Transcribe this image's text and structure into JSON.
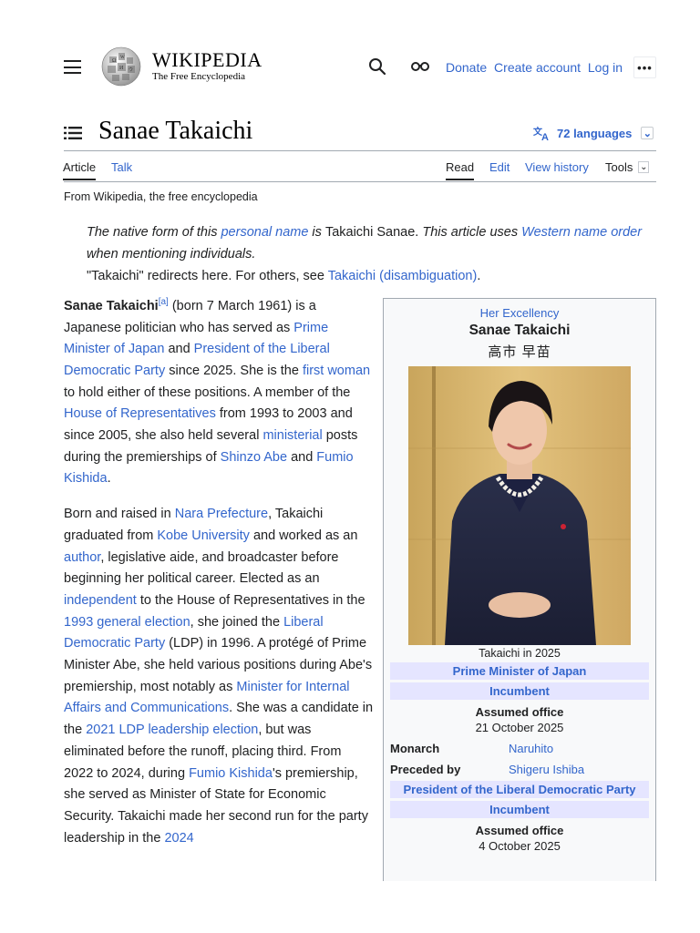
{
  "header": {
    "wordmark_title": "WIKIPEDIA",
    "wordmark_tagline": "The Free Encyclopedia",
    "links": [
      "Donate",
      "Create account",
      "Log in"
    ]
  },
  "page": {
    "title": "Sanae Takaichi",
    "languages": "72 languages",
    "tabs_left": [
      "Article",
      "Talk"
    ],
    "tabs_right": [
      "Read",
      "Edit",
      "View history"
    ],
    "tools": "Tools",
    "tagline": "From Wikipedia, the free encyclopedia"
  },
  "hatnote": {
    "p1": "The native form of this ",
    "p1_link": "personal name",
    "p2": " is ",
    "p2_plain": "Takaichi Sanae.",
    "p3": " This article uses ",
    "p3_link": "Western name order",
    "p4": " when mentioning individuals.",
    "p5": "\"Takaichi\" redirects here. For others, see ",
    "p5_link": "Takaichi (disambiguation)",
    "p5_end": "."
  },
  "lead": {
    "para1": [
      {
        "t": "Sanae Takaichi",
        "b": true
      },
      {
        "t": "[a]",
        "sup": true,
        "link": true
      },
      {
        "t": " (born 7 March 1961) is a Japanese politician who has served as "
      },
      {
        "t": "Prime Minister of Japan",
        "link": true
      },
      {
        "t": " and "
      },
      {
        "t": "President of the Liberal Democratic Party",
        "link": true
      },
      {
        "t": " since 2025. She is the "
      },
      {
        "t": "first woman",
        "link": true
      },
      {
        "t": " to hold either of these positions. A member of the "
      },
      {
        "t": "House of Representatives",
        "link": true
      },
      {
        "t": " from 1993 to 2003 and since 2005, she also held several "
      },
      {
        "t": "ministerial",
        "link": true
      },
      {
        "t": " posts during the premierships of "
      },
      {
        "t": "Shinzo Abe",
        "link": true
      },
      {
        "t": " and "
      },
      {
        "t": "Fumio Kishida",
        "link": true
      },
      {
        "t": "."
      }
    ],
    "para2": [
      {
        "t": "Born and raised in "
      },
      {
        "t": "Nara Prefecture",
        "link": true
      },
      {
        "t": ", Takaichi graduated from "
      },
      {
        "t": "Kobe University",
        "link": true
      },
      {
        "t": " and worked as an "
      },
      {
        "t": "author",
        "link": true
      },
      {
        "t": ", legislative aide, and broadcaster before beginning her political career. Elected as an "
      },
      {
        "t": "independent",
        "link": true
      },
      {
        "t": " to the House of Representatives in the "
      },
      {
        "t": "1993 general election",
        "link": true
      },
      {
        "t": ", she joined the "
      },
      {
        "t": "Liberal Democratic Party",
        "link": true
      },
      {
        "t": " (LDP) in 1996. A protégé of Prime Minister Abe, she held various positions during Abe's premiership, most notably as "
      },
      {
        "t": "Minister for Internal Affairs and Communications",
        "link": true
      },
      {
        "t": ". She was a candidate in the "
      },
      {
        "t": "2021 LDP leadership election",
        "link": true
      },
      {
        "t": ", but was eliminated before the runoff, placing third. From 2022 to 2024, during "
      },
      {
        "t": "Fumio Kishida",
        "link": true
      },
      {
        "t": "'s premiership, she served as Minister of State for Economic Security. Takaichi made her second run for the party leadership in the "
      },
      {
        "t": "2024",
        "link": true
      }
    ]
  },
  "infobox": {
    "honorific": "Her Excellency",
    "name": "Sanae Takaichi",
    "native_name": "高市 早苗",
    "caption": "Takaichi in 2025",
    "office1": "Prime Minister of Japan",
    "status1": "Incumbent",
    "assumed_label1": "Assumed office",
    "assumed_date1": "21 October 2025",
    "monarch_label": "Monarch",
    "monarch": "Naruhito",
    "preceded_label": "Preceded by",
    "preceded": "Shigeru Ishiba",
    "office2": "President of the Liberal Democratic Party",
    "status2": "Incumbent",
    "assumed_label2": "Assumed office",
    "assumed_date2": "4 October 2025"
  },
  "colors": {
    "link": "#3366cc",
    "band": "#e5e5ff",
    "infobox_bg": "#f8f9fa"
  }
}
